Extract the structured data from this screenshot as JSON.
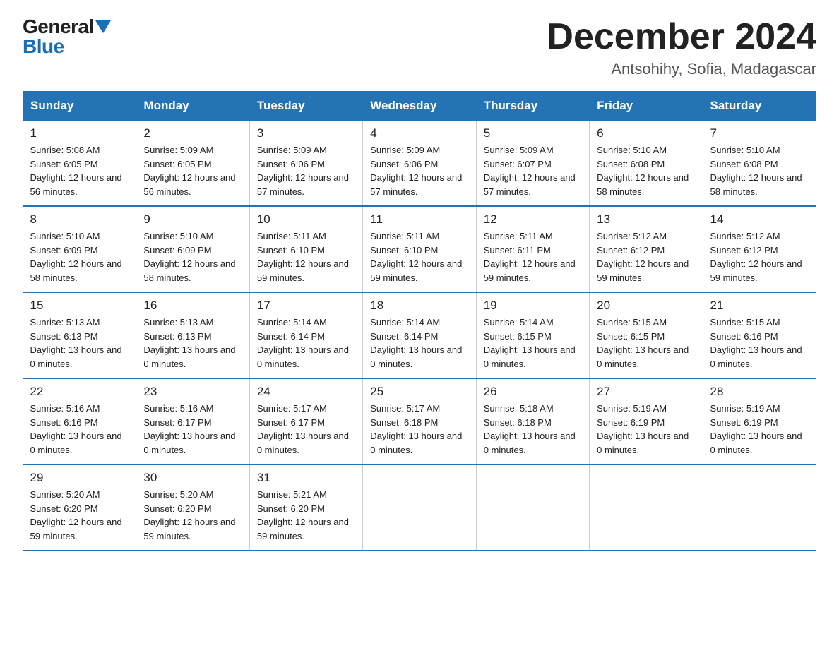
{
  "logo": {
    "general": "General",
    "blue": "Blue"
  },
  "title": "December 2024",
  "location": "Antsohihy, Sofia, Madagascar",
  "days_of_week": [
    "Sunday",
    "Monday",
    "Tuesday",
    "Wednesday",
    "Thursday",
    "Friday",
    "Saturday"
  ],
  "weeks": [
    [
      {
        "day": "1",
        "sunrise": "5:08 AM",
        "sunset": "6:05 PM",
        "daylight": "12 hours and 56 minutes."
      },
      {
        "day": "2",
        "sunrise": "5:09 AM",
        "sunset": "6:05 PM",
        "daylight": "12 hours and 56 minutes."
      },
      {
        "day": "3",
        "sunrise": "5:09 AM",
        "sunset": "6:06 PM",
        "daylight": "12 hours and 57 minutes."
      },
      {
        "day": "4",
        "sunrise": "5:09 AM",
        "sunset": "6:06 PM",
        "daylight": "12 hours and 57 minutes."
      },
      {
        "day": "5",
        "sunrise": "5:09 AM",
        "sunset": "6:07 PM",
        "daylight": "12 hours and 57 minutes."
      },
      {
        "day": "6",
        "sunrise": "5:10 AM",
        "sunset": "6:08 PM",
        "daylight": "12 hours and 58 minutes."
      },
      {
        "day": "7",
        "sunrise": "5:10 AM",
        "sunset": "6:08 PM",
        "daylight": "12 hours and 58 minutes."
      }
    ],
    [
      {
        "day": "8",
        "sunrise": "5:10 AM",
        "sunset": "6:09 PM",
        "daylight": "12 hours and 58 minutes."
      },
      {
        "day": "9",
        "sunrise": "5:10 AM",
        "sunset": "6:09 PM",
        "daylight": "12 hours and 58 minutes."
      },
      {
        "day": "10",
        "sunrise": "5:11 AM",
        "sunset": "6:10 PM",
        "daylight": "12 hours and 59 minutes."
      },
      {
        "day": "11",
        "sunrise": "5:11 AM",
        "sunset": "6:10 PM",
        "daylight": "12 hours and 59 minutes."
      },
      {
        "day": "12",
        "sunrise": "5:11 AM",
        "sunset": "6:11 PM",
        "daylight": "12 hours and 59 minutes."
      },
      {
        "day": "13",
        "sunrise": "5:12 AM",
        "sunset": "6:12 PM",
        "daylight": "12 hours and 59 minutes."
      },
      {
        "day": "14",
        "sunrise": "5:12 AM",
        "sunset": "6:12 PM",
        "daylight": "12 hours and 59 minutes."
      }
    ],
    [
      {
        "day": "15",
        "sunrise": "5:13 AM",
        "sunset": "6:13 PM",
        "daylight": "13 hours and 0 minutes."
      },
      {
        "day": "16",
        "sunrise": "5:13 AM",
        "sunset": "6:13 PM",
        "daylight": "13 hours and 0 minutes."
      },
      {
        "day": "17",
        "sunrise": "5:14 AM",
        "sunset": "6:14 PM",
        "daylight": "13 hours and 0 minutes."
      },
      {
        "day": "18",
        "sunrise": "5:14 AM",
        "sunset": "6:14 PM",
        "daylight": "13 hours and 0 minutes."
      },
      {
        "day": "19",
        "sunrise": "5:14 AM",
        "sunset": "6:15 PM",
        "daylight": "13 hours and 0 minutes."
      },
      {
        "day": "20",
        "sunrise": "5:15 AM",
        "sunset": "6:15 PM",
        "daylight": "13 hours and 0 minutes."
      },
      {
        "day": "21",
        "sunrise": "5:15 AM",
        "sunset": "6:16 PM",
        "daylight": "13 hours and 0 minutes."
      }
    ],
    [
      {
        "day": "22",
        "sunrise": "5:16 AM",
        "sunset": "6:16 PM",
        "daylight": "13 hours and 0 minutes."
      },
      {
        "day": "23",
        "sunrise": "5:16 AM",
        "sunset": "6:17 PM",
        "daylight": "13 hours and 0 minutes."
      },
      {
        "day": "24",
        "sunrise": "5:17 AM",
        "sunset": "6:17 PM",
        "daylight": "13 hours and 0 minutes."
      },
      {
        "day": "25",
        "sunrise": "5:17 AM",
        "sunset": "6:18 PM",
        "daylight": "13 hours and 0 minutes."
      },
      {
        "day": "26",
        "sunrise": "5:18 AM",
        "sunset": "6:18 PM",
        "daylight": "13 hours and 0 minutes."
      },
      {
        "day": "27",
        "sunrise": "5:19 AM",
        "sunset": "6:19 PM",
        "daylight": "13 hours and 0 minutes."
      },
      {
        "day": "28",
        "sunrise": "5:19 AM",
        "sunset": "6:19 PM",
        "daylight": "13 hours and 0 minutes."
      }
    ],
    [
      {
        "day": "29",
        "sunrise": "5:20 AM",
        "sunset": "6:20 PM",
        "daylight": "12 hours and 59 minutes."
      },
      {
        "day": "30",
        "sunrise": "5:20 AM",
        "sunset": "6:20 PM",
        "daylight": "12 hours and 59 minutes."
      },
      {
        "day": "31",
        "sunrise": "5:21 AM",
        "sunset": "6:20 PM",
        "daylight": "12 hours and 59 minutes."
      },
      null,
      null,
      null,
      null
    ]
  ]
}
